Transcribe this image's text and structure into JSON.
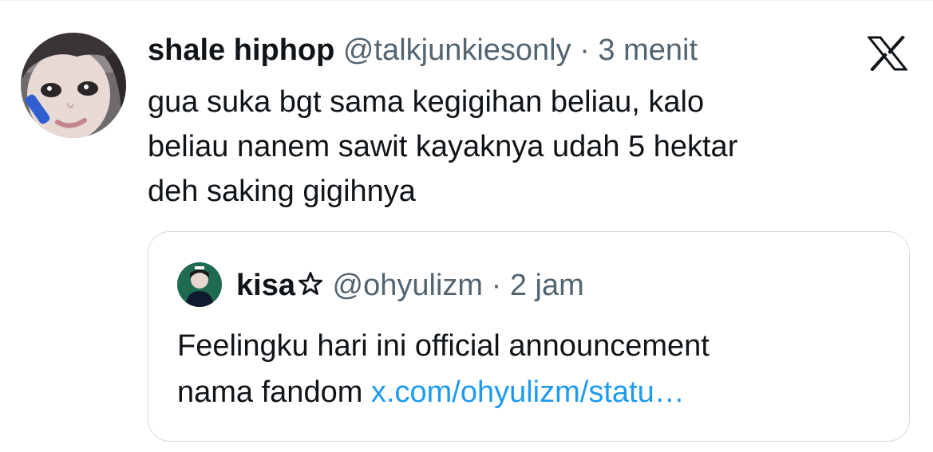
{
  "tweet": {
    "display_name": "shale hiphop",
    "handle": "@talkjunkiesonly",
    "separator": "·",
    "time": "3 menit",
    "text_line1": "gua suka bgt sama kegigihan beliau, kalo",
    "text_line2": "beliau nanem sawit kayaknya udah 5 hektar",
    "text_line3": "deh saking gigihnya",
    "avatar_icon": "profile-photo",
    "brand_icon": "x-logo-icon"
  },
  "quote": {
    "display_name": "kisa",
    "name_badge_icon": "star-outline-icon",
    "handle": "@ohyulizm",
    "separator": "·",
    "time": "2 jam",
    "text_line1": "Feelingku hari ini official announcement",
    "text_prefix_line2": "nama fandom ",
    "link_text": "x.com/ohyulizm/statu…",
    "avatar_icon": "profile-photo"
  },
  "colors": {
    "text_primary": "#0f1419",
    "text_secondary": "#536471",
    "link": "#1d9bf0",
    "border": "#cfd9de"
  }
}
